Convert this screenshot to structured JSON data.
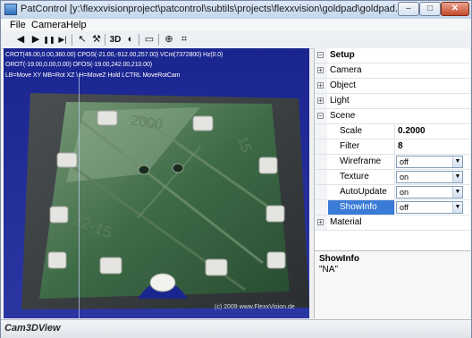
{
  "window": {
    "title": "PatControl [y:\\flexxvisionproject\\patcontrol\\subtils\\projects\\flexxvision\\goldpad\\goldpad.set]",
    "minimize": "–",
    "maximize": "□",
    "close": "✕"
  },
  "menu": [
    "File",
    "Camera",
    "Help"
  ],
  "toolbar": {
    "first": "◀",
    "play": "▶",
    "pause": "❚❚",
    "last": "▶|",
    "pick": "↖",
    "tool": "⚒",
    "view3d": "3D",
    "view3d_icon": "◐",
    "rect": "▭",
    "fit": "⊕",
    "crop": "⌗"
  },
  "viewport": {
    "info_lines": [
      "CROT(46.00,0.00,360.00) CPOS(-21.00,-912.00,257.00) VCnt(7372800) Hz(0.0)",
      "OROT(-19.00,0.00,0.00) OFOS(-19.00,242.00,210.00)",
      "LB=Move XY MB=Rot XZ \\ H=MoveZ Hold LCTRL MoveRotCam"
    ],
    "watermark": "(c) 2009 www.FlexxVision.de",
    "engraving_1": "2000",
    "engraving_2": "32-15",
    "engraving_3": "15"
  },
  "properties": {
    "groups": [
      {
        "label": "Setup",
        "expander": "−",
        "bold": true
      },
      {
        "label": "Camera",
        "expander": "+"
      },
      {
        "label": "Object",
        "expander": "+"
      },
      {
        "label": "Light",
        "expander": "+"
      },
      {
        "label": "Scene",
        "expander": "−"
      }
    ],
    "scene": [
      {
        "name": "Scale",
        "value": "0.2000"
      },
      {
        "name": "Filter",
        "value": "8"
      },
      {
        "name": "Wireframe",
        "value": "off"
      },
      {
        "name": "Texture",
        "value": "on"
      },
      {
        "name": "AutoUpdate",
        "value": "on"
      },
      {
        "name": "ShowInfo",
        "value": "off"
      }
    ],
    "material": {
      "label": "Material",
      "expander": "+"
    },
    "dropdown_arrow": "▼",
    "help_title": "ShowInfo",
    "help_desc": "\"NA\""
  },
  "status": {
    "text": "Cam3DView"
  },
  "colors": {
    "accent": "#3a7bd5",
    "viewport_bg": "#1f2a8e",
    "board": "#2f5a36"
  }
}
